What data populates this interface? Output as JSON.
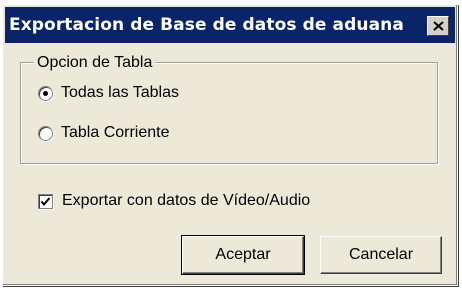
{
  "window": {
    "title": "Exportacion de Base de datos de aduana",
    "close_symbol": "close-icon"
  },
  "table_options": {
    "legend": "Opcion de Tabla",
    "options": [
      {
        "label": "Todas las Tablas",
        "selected": true
      },
      {
        "label": "Tabla Corriente",
        "selected": false
      }
    ]
  },
  "export_media": {
    "label": "Exportar con datos de Vídeo/Audio",
    "checked": true
  },
  "buttons": {
    "ok_label": "Aceptar",
    "cancel_label": "Cancelar"
  }
}
